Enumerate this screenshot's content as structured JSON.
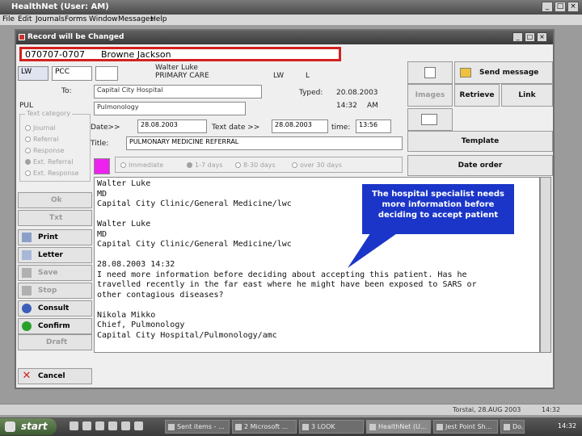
{
  "app": {
    "title": "HealthNet (User: AM)",
    "menu": [
      "File",
      "Edit",
      "Journals",
      "Forms",
      "Window",
      "Messages",
      "Help"
    ]
  },
  "dialog": {
    "title": "Record will be Changed",
    "patient_id": "070707-0707",
    "patient_name": "Browne Jackson",
    "sender_code": "LW",
    "sender_unit": "PCC",
    "from_name": "Walter Luke",
    "from_role": "PRIMARY CARE",
    "from_code": "LW",
    "from_code2": "L",
    "to_label": "To:",
    "to_value": "Capital City Hospital",
    "typed_label": "Typed:",
    "typed_date": "20.08.2003",
    "typed_time": "14:32",
    "typed_ampm": "AM",
    "pul_label": "PUL",
    "pul_value": "Pulmonology",
    "category_legend": "Text category",
    "categories": [
      "Journal",
      "Referral",
      "Response",
      "Ext. Referral",
      "Ext. Response"
    ],
    "date_label": "Date>>",
    "date_value": "28.08.2003",
    "text_date_label": "Text date >>",
    "text_date_value": "28.08.2003",
    "time_label": "time:",
    "time_value": "13:56",
    "title_label": "Title:",
    "title_value": "PULMONARY MEDICINE REFERRAL",
    "urgency": [
      "Immediate",
      "1-7 days",
      "8-30 days",
      "over 30 days"
    ],
    "buttons": {
      "send_message": "Send message",
      "images": "Images",
      "retrieve": "Retrieve",
      "link": "Link",
      "template": "Template",
      "date_order": "Date order",
      "ok": "Ok",
      "txt": "Txt",
      "print": "Print",
      "letter": "Letter",
      "save": "Save",
      "stop": "Stop",
      "consult": "Consult",
      "confirm": "Confirm",
      "draft": "Draft",
      "cancel": "Cancel"
    },
    "message_lines": [
      "Walter Luke",
      "MD",
      "Capital City Clinic/General Medicine/lwc",
      "",
      "Walter Luke",
      "MD",
      "Capital City Clinic/General Medicine/lwc",
      "",
      "28.08.2003 14:32",
      "I need more information before deciding about accepting this patient. Has he",
      "travelled recently in the far east where he might have been exposed to SARS or",
      "other contagious diseases?",
      "",
      "Nikola Mikko",
      "Chief, Pulmonology",
      "Capital City Hospital/Pulmonology/amc"
    ]
  },
  "callout": {
    "text": "The hospital specialist needs more information before deciding to accept patient"
  },
  "status": {
    "date": "Torstai, 28.AUG 2003",
    "time": "14:32"
  },
  "taskbar": {
    "start": "start",
    "tasks": [
      "Sent items - ...",
      "2 Microsoft ...",
      "3 LOOK",
      "HealthNet (U...",
      "Jest Point Sh...",
      "Do..."
    ],
    "clock": "14:32"
  },
  "colors": {
    "patient_border": "#d42020",
    "callout_bg": "#1a35c8",
    "color_swatch": "#ee22ee"
  }
}
